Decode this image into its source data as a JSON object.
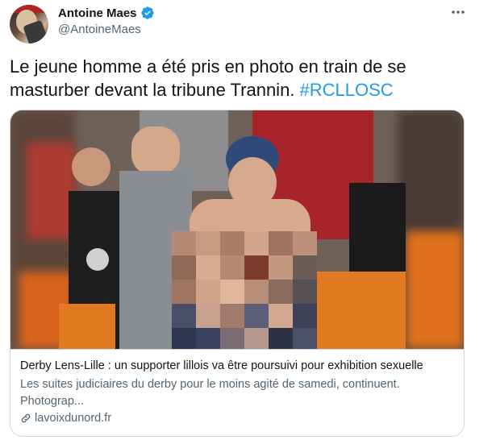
{
  "author": {
    "name": "Antoine Maes",
    "handle": "@AntoineMaes"
  },
  "tweet": {
    "text": "Le jeune homme a été pris en photo en train de se masturber devant la tribune Trannin. ",
    "hashtag": "#RCLLOSC"
  },
  "card": {
    "title": "Derby Lens-Lille : un supporter lillois va être poursuivi pour exhibition sexuelle",
    "description": "Les suites judiciaires du derby pour le moins agité de samedi, continuent. Photograp...",
    "domain": "lavoixdunord.fr"
  },
  "colors": {
    "accent": "#1d9bf0",
    "secondary_text": "#536471",
    "border": "#cfd9de"
  },
  "icons": [
    "verified-badge-icon",
    "more-options-icon",
    "link-icon"
  ]
}
